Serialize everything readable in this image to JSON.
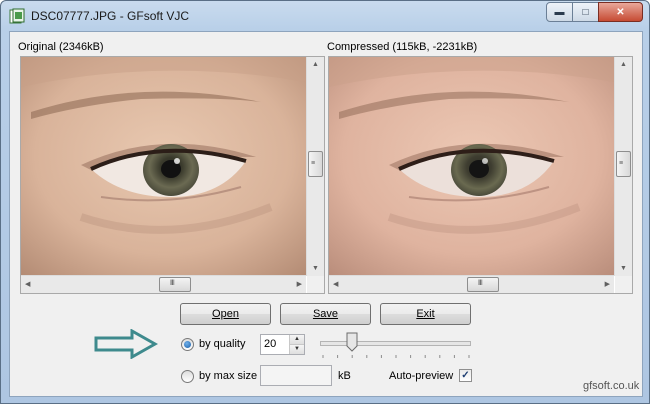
{
  "window": {
    "title": "DSC07777.JPG - GFsoft VJC",
    "icon": "app-icon",
    "caption_buttons": {
      "minimize": "minimize-icon",
      "maximize": "maximize-icon",
      "close": "close-icon"
    }
  },
  "panes": {
    "original_label": "Original (2346kB)",
    "compressed_label": "Compressed (115kB, -2231kB)"
  },
  "buttons": {
    "open": "Open",
    "save": "Save",
    "exit": "Exit"
  },
  "options": {
    "by_quality_label": "by quality",
    "by_quality_selected": true,
    "quality_value": "20",
    "by_max_size_label": "by max size",
    "max_size_value": "",
    "size_unit": "kB",
    "auto_preview_label": "Auto-preview",
    "auto_preview_checked": true,
    "quality_slider_fraction": 0.2
  },
  "footer": {
    "site": "gfsoft.co.uk"
  },
  "colors": {
    "arrow": "#3e8a8d",
    "skin": "#c9a48e",
    "accent": "#1c5fa8"
  }
}
